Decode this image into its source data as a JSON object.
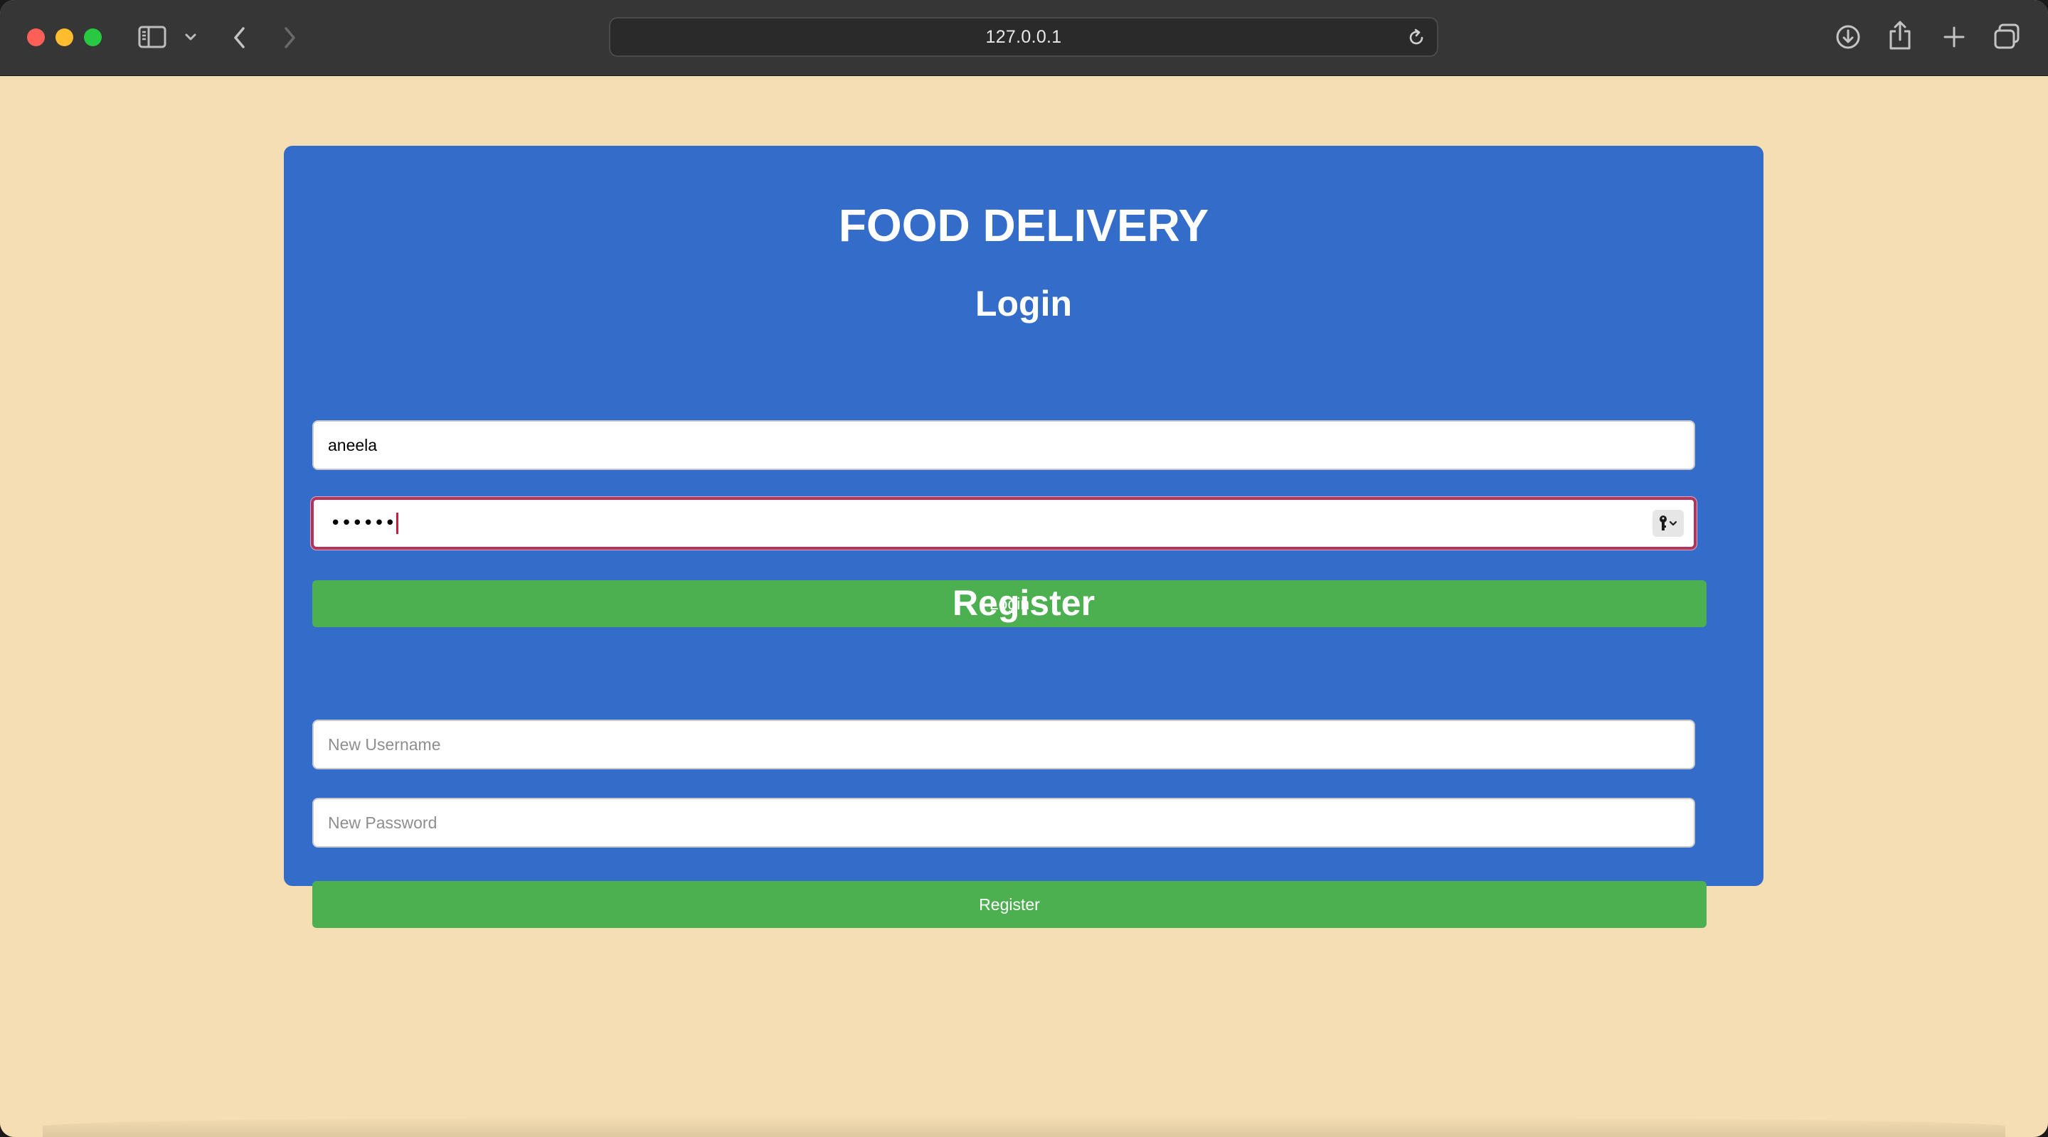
{
  "browser": {
    "address": "127.0.0.1",
    "icons": {
      "sidebar_toggle": "sidebar-icon",
      "sidebar_menu": "chevron-down-icon",
      "back": "chevron-left-icon",
      "forward": "chevron-right-icon",
      "reload": "reload-icon",
      "download": "download-icon",
      "share": "share-icon",
      "new_tab": "plus-icon",
      "tab_overview": "tabs-icon"
    }
  },
  "page": {
    "background_color": "#f5deb3",
    "card_color": "#336dc9",
    "button_color": "#4caf50",
    "title": "FOOD DELIVERY",
    "login": {
      "heading": "Login",
      "username_value": "aneela",
      "password_masked": "••••••",
      "button_label": "Login"
    },
    "register": {
      "heading": "Register",
      "username_placeholder": "New Username",
      "password_placeholder": "New Password",
      "button_label": "Register"
    }
  }
}
